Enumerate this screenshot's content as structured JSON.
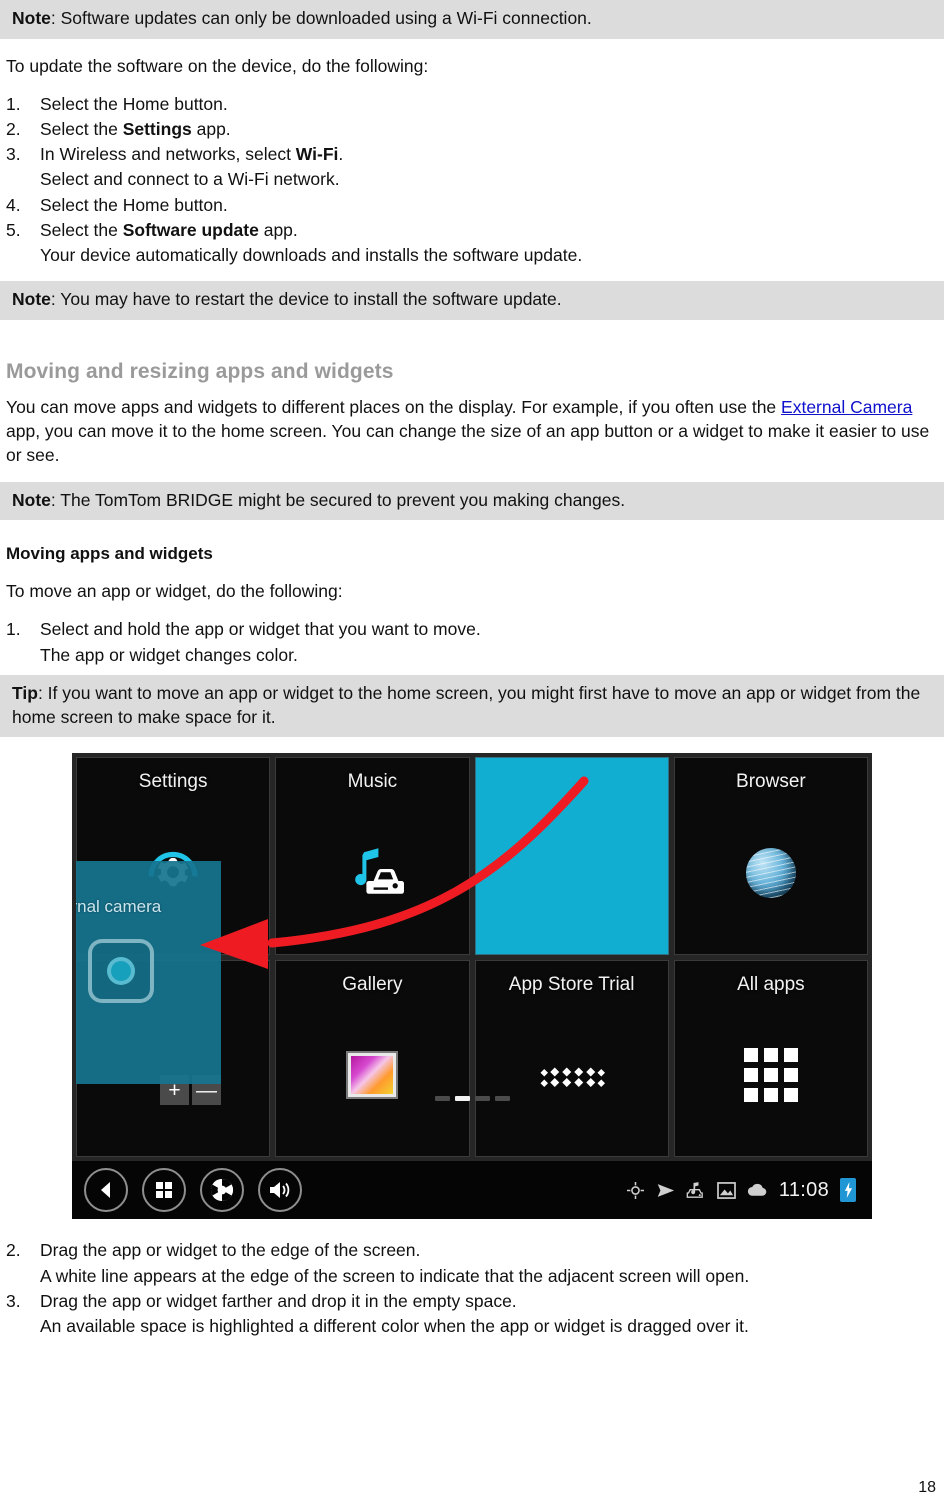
{
  "notes": {
    "wifi_note_label": "Note",
    "wifi_note_text": ": Software updates can only be downloaded using a Wi-Fi connection.",
    "restart_note_label": "Note",
    "restart_note_text": ": You may have to restart the device to install the software update.",
    "secured_note_label": "Note",
    "secured_note_text": ": The TomTom BRIDGE might be secured to prevent you making changes.",
    "tip_label": "Tip",
    "tip_text": ": If you want to move an app or widget to the home screen, you might first have to move an app or widget from the home screen to make space for it."
  },
  "intro": {
    "update_lead": "To update the software on the device, do the following:"
  },
  "update_steps": [
    {
      "num": "1.",
      "pre": "Select the Home button.",
      "bold": "",
      "post": ""
    },
    {
      "num": "2.",
      "pre": "Select the ",
      "bold": "Settings",
      "post": " app."
    },
    {
      "num": "3.",
      "pre": "In Wireless and networks, select ",
      "bold": "Wi-Fi",
      "post": "."
    },
    {
      "num": "4.",
      "pre": "Select the Home button.",
      "bold": "",
      "post": ""
    },
    {
      "num": "5.",
      "pre": "Select the ",
      "bold": "Software update",
      "post": " app."
    }
  ],
  "update_substeps": {
    "after_step3": "Select and connect to a Wi-Fi network.",
    "after_step5": "Your device automatically downloads and installs the software update."
  },
  "moving_section": {
    "heading": "Moving and resizing apps and widgets",
    "body_part1": "You can move apps and widgets to different places on the display. For example, if you often use the ",
    "link_text": "External Camera",
    "body_part2": " app, you can move it to the home screen. You can change the size of an app button or a widget to make it easier to use or see.",
    "subheading": "Moving apps and widgets",
    "move_lead": "To move an app or widget, do the following:",
    "step1_num": "1.",
    "step1_text": "Select and hold the app or widget that you want to move.",
    "step1_sub": "The app or widget changes color."
  },
  "after_steps": [
    {
      "num": "2.",
      "text": "Drag the app or widget to the edge of the screen.",
      "sub": "A white line appears at the edge of the screen to indicate that the adjacent screen will open."
    },
    {
      "num": "3.",
      "text": "Drag the app or widget farther and drop it in the empty space.",
      "sub": "An available space is highlighted a different color when the app or widget is dragged over it."
    }
  ],
  "device": {
    "tiles": [
      {
        "label": "Settings",
        "icon": "gear-icon"
      },
      {
        "label": "Music",
        "icon": "music-car-icon"
      },
      {
        "label": "",
        "icon": "empty-highlight"
      },
      {
        "label": "Browser",
        "icon": "globe-icon"
      },
      {
        "label": "",
        "icon": "hidden-by-widget"
      },
      {
        "label": "Gallery",
        "icon": "gallery-icon"
      },
      {
        "label": "App Store Trial",
        "icon": "app-store-icon"
      },
      {
        "label": "All apps",
        "icon": "all-apps-grid-icon"
      }
    ],
    "drag_widget_label": "ernal camera",
    "resize_plus": "+",
    "resize_minus": "—",
    "page_dots": [
      false,
      true,
      false,
      false
    ],
    "nav_buttons": [
      "back-icon",
      "recent-apps-icon",
      "camera-shutter-icon",
      "volume-icon"
    ],
    "status_icons": [
      "gps-icon",
      "navigation-arrow-icon",
      "music-car-status-icon",
      "image-icon",
      "cloud-icon"
    ],
    "time": "11:08",
    "battery": "battery-charging-icon",
    "colors": {
      "highlight_tile": "#12aed1",
      "drag_widget": "#16748f",
      "arrow": "#ee1c22",
      "accent_cyan": "#1fc4e8"
    }
  },
  "footer": {
    "page_number": "18"
  }
}
